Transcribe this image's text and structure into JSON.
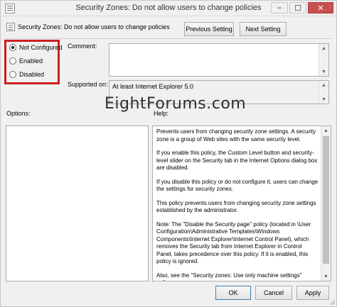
{
  "window": {
    "title": "Security Zones: Do not allow users to change policies",
    "controls": {
      "minimize": "–",
      "maximize": "☐",
      "close": "✕"
    }
  },
  "header": {
    "policy_name": "Security Zones: Do not allow users to change policies",
    "prev_button": "Previous Setting",
    "next_button": "Next Setting"
  },
  "options": {
    "radios": [
      {
        "label": "Not Configured",
        "checked": true
      },
      {
        "label": "Enabled",
        "checked": false
      },
      {
        "label": "Disabled",
        "checked": false
      }
    ],
    "highlight_color": "#cc1f1f"
  },
  "labels": {
    "comment": "Comment:",
    "supported_on": "Supported on:",
    "options": "Options:",
    "help": "Help:"
  },
  "supported_on_value": "At least Internet Explorer 5.0",
  "watermark": "EightForums.com",
  "help": {
    "paragraphs": [
      "Prevents users from changing security zone settings. A security zone is a group of Web sites with the same security level.",
      "If you enable this policy, the Custom Level button and security-level slider on the Security tab in the Internet Options dialog box are disabled.",
      "If you disable this policy or do not configure it, users can change the settings for security zones.",
      "This policy prevents users from changing security zone settings established by the administrator.",
      "Note: The \"Disable the Security page\" policy (located in \\User Configuration\\Administrative Templates\\Windows Components\\Internet Explorer\\Internet Control Panel), which removes the Security tab from Internet Explorer in Control Panel, takes precedence over this policy. If it is enabled, this policy is ignored.",
      "Also, see the \"Security zones: Use only machine settings\" policy."
    ]
  },
  "footer": {
    "ok": "OK",
    "cancel": "Cancel",
    "apply": "Apply"
  }
}
